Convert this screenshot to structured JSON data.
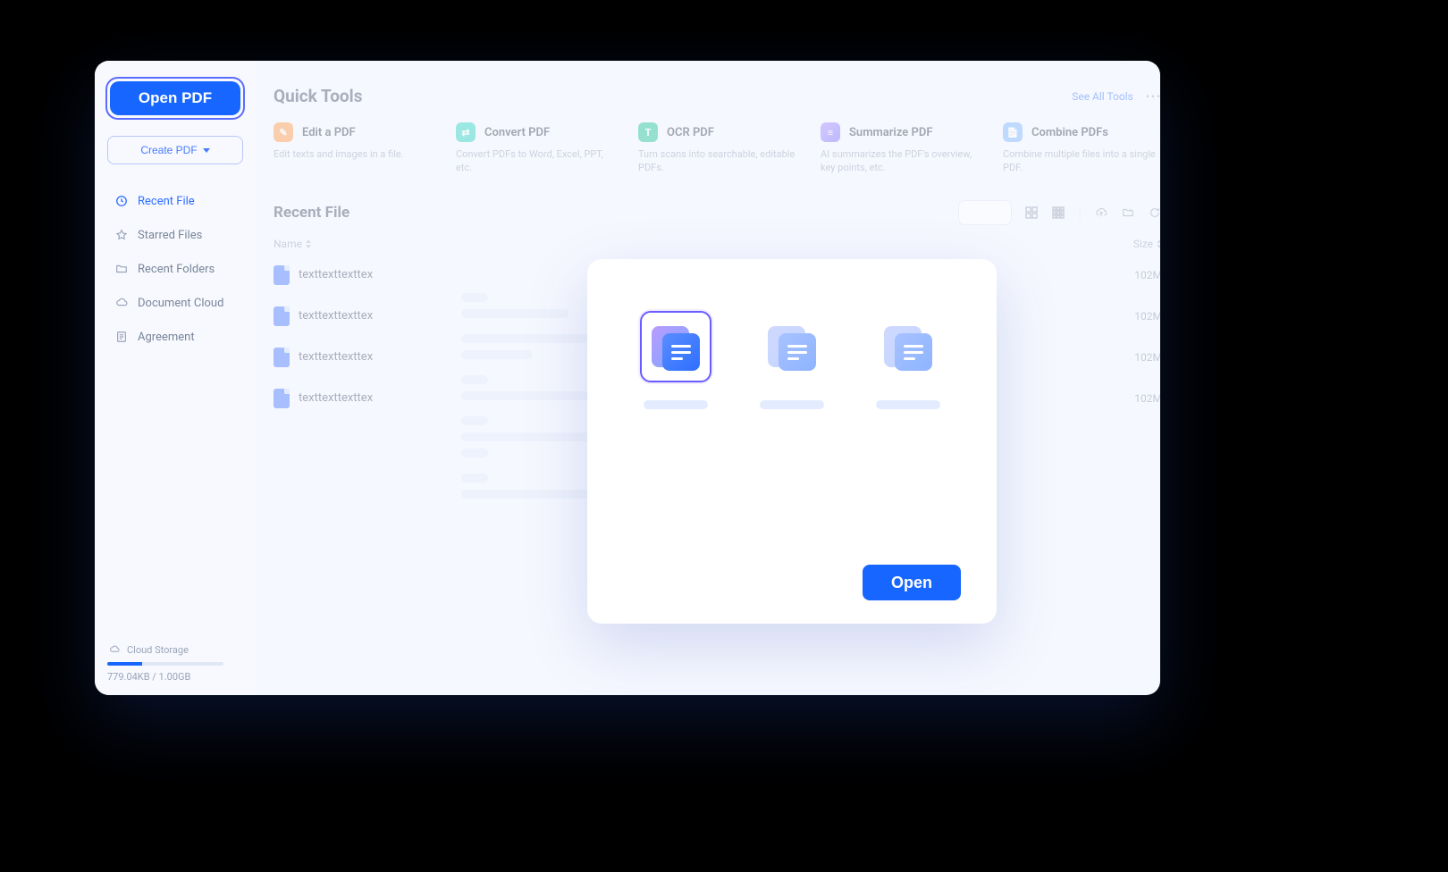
{
  "sidebar": {
    "open_pdf_label": "Open PDF",
    "create_pdf_label": "Create PDF",
    "items": [
      {
        "label": "Recent File",
        "icon": "clock-icon",
        "active": true
      },
      {
        "label": "Starred Files",
        "icon": "star-icon",
        "active": false
      },
      {
        "label": "Recent Folders",
        "icon": "folder-icon",
        "active": false
      },
      {
        "label": "Document Cloud",
        "icon": "cloud-icon",
        "active": false
      },
      {
        "label": "Agreement",
        "icon": "document-icon",
        "active": false
      }
    ],
    "storage_label": "Cloud Storage",
    "storage_text": "779.04KB / 1.00GB"
  },
  "quick_tools": {
    "heading": "Quick Tools",
    "see_all_label": "See All Tools",
    "tools": [
      {
        "title": "Edit a PDF",
        "desc": "Edit texts and images in a file.",
        "icon": "edit-icon",
        "color": "ic-edit"
      },
      {
        "title": "Convert PDF",
        "desc": "Convert PDFs to Word, Excel, PPT, etc.",
        "icon": "convert-icon",
        "color": "ic-conv"
      },
      {
        "title": "OCR PDF",
        "desc": "Turn scans into searchable, editable PDFs.",
        "icon": "ocr-icon",
        "color": "ic-ocr"
      },
      {
        "title": "Summarize PDF",
        "desc": "AI summarizes the PDF's overview, key points, etc.",
        "icon": "summarize-icon",
        "color": "ic-sum"
      },
      {
        "title": "Combine PDFs",
        "desc": "Combine multiple files into a single PDF.",
        "icon": "combine-icon",
        "color": "ic-comb"
      }
    ]
  },
  "recent": {
    "heading": "Recent File",
    "col_name": "Name",
    "col_size": "Size",
    "rows": [
      {
        "name": "texttexttexttex",
        "size": "102M"
      },
      {
        "name": "texttexttexttex",
        "size": "102M"
      },
      {
        "name": "texttexttexttex",
        "size": "102M"
      },
      {
        "name": "texttexttexttex",
        "size": "102M"
      }
    ]
  },
  "modal": {
    "open_label": "Open"
  }
}
